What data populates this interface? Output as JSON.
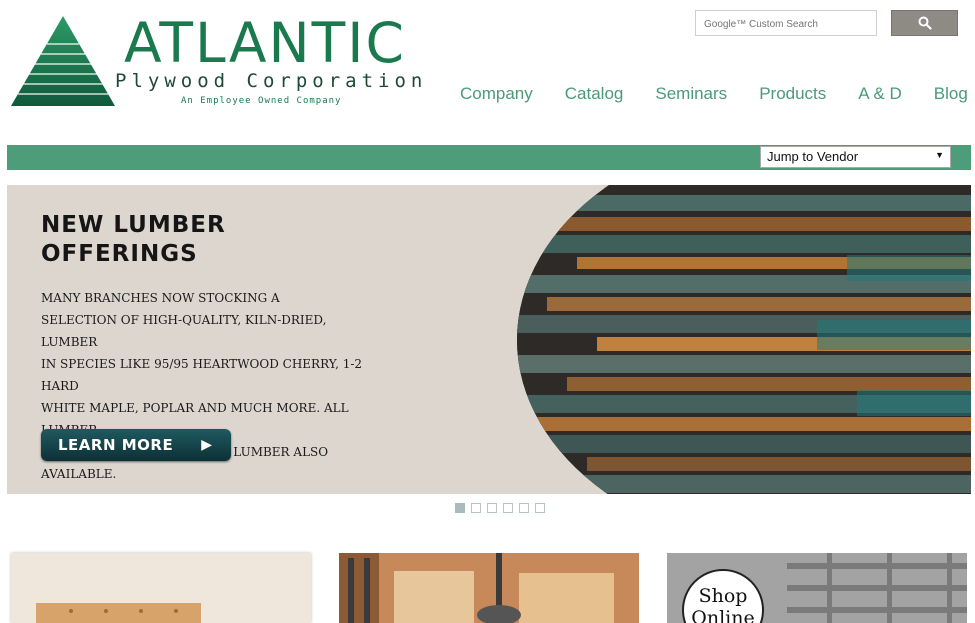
{
  "logo": {
    "word": "ATLANTIC",
    "sub": "Plywood Corporation",
    "tagline": "An Employee Owned Company"
  },
  "search": {
    "placeholder": "Google™ Custom Search",
    "button_icon": "search-icon"
  },
  "nav": [
    "Company",
    "Catalog",
    "Seminars",
    "Products",
    "A & D",
    "Blog"
  ],
  "vendor_select": {
    "value": "Jump to Vendor"
  },
  "hero": {
    "title": "NEW LUMBER\nOFFERINGS",
    "text": "MANY BRANCHES NOW STOCKING A\nSELECTION OF HIGH-QUALITY, KILN-DRIED,  LUMBER\nIN SPECIES LIKE 95/95 HEARTWOOD CHERRY, 1-2 HARD\nWHITE MAPLE, POPLAR AND MUCH MORE. ALL LUMBER\nIS SOLD ON A NET TALLY. 4/4 LUMBER ALSO AVAILABLE.",
    "button_label": "LEARN MORE"
  },
  "slider": {
    "count": 6,
    "active": 1
  },
  "tiles": {
    "shop_label": "Shop\nOnline"
  },
  "colors": {
    "brand_green": "#1a7a4e",
    "bar_green": "#4d9d7b",
    "nav_green": "#4a9a78"
  }
}
